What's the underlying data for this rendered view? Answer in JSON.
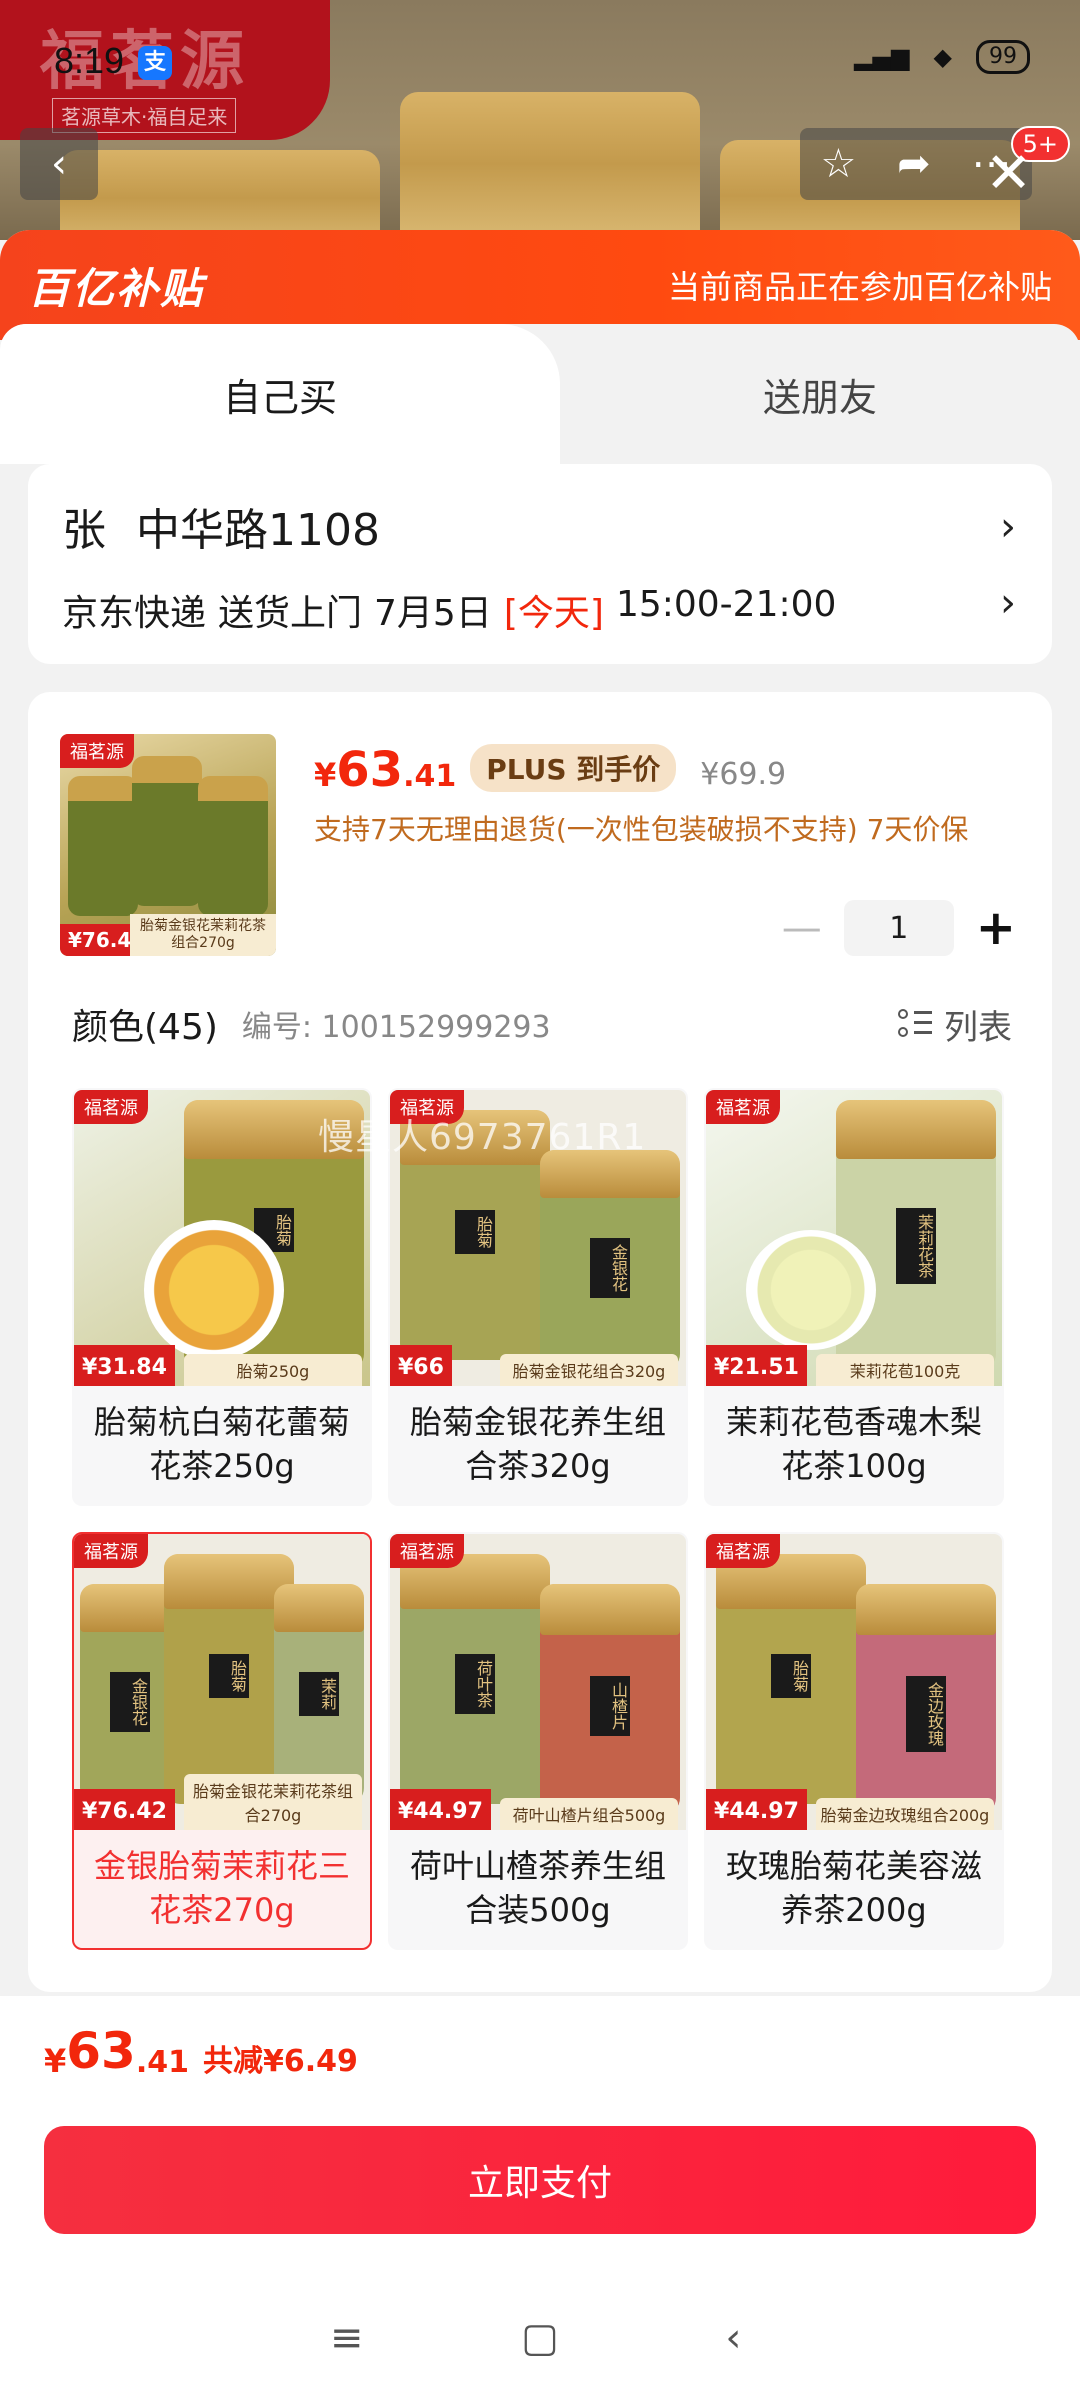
{
  "status": {
    "time": "8:19",
    "app_badge": "支",
    "battery": "99"
  },
  "background": {
    "brand_logo": "福茗源",
    "brand_slogan": "茗源草木·福自足来",
    "cart_count": "5+"
  },
  "banner": {
    "logo": "百亿补贴",
    "text": "当前商品正在参加百亿补贴"
  },
  "tabs": {
    "self": "自己买",
    "friend": "送朋友"
  },
  "address": {
    "name": "张",
    "street": "中华路1108",
    "courier": "京东快递",
    "delivery": "送货上门",
    "date": "7月5日",
    "today": "[今天]",
    "time": "15:00-21:00"
  },
  "product": {
    "thumb": {
      "brand": "福茗源",
      "price": "¥76.42",
      "desc": "胎菊金银花茉莉花茶组合270g"
    },
    "price_yen": "¥",
    "price_int": "63",
    "price_dec": ".41",
    "plus_badge": "PLUS 到手价",
    "price_old": "¥69.9",
    "service": "支持7天无理由退货(一次性包装破损不支持) 7天价保",
    "qty": "1"
  },
  "color_section": {
    "title": "颜色(45)",
    "code": "编号: 100152999293",
    "list_label": "列表",
    "watermark": "慢星人6973761R1",
    "options": [
      {
        "name": "胎菊杭白菊花蕾菊花茶250g",
        "price": "¥31.84",
        "desc": "胎菊250g",
        "brand": "福茗源",
        "selected": false
      },
      {
        "name": "胎菊金银花养生组合茶320g",
        "price": "¥66",
        "desc": "胎菊金银花组合320g",
        "brand": "福茗源",
        "selected": false
      },
      {
        "name": "茉莉花苞香魂木梨花茶100g",
        "price": "¥21.51",
        "desc": "茉莉花苞100克",
        "brand": "福茗源",
        "selected": false
      },
      {
        "name": "金银胎菊茉莉花三花茶270g",
        "price": "¥76.42",
        "desc": "胎菊金银花茉莉花茶组合270g",
        "brand": "福茗源",
        "selected": true
      },
      {
        "name": "荷叶山楂茶养生组合装500g",
        "price": "¥44.97",
        "desc": "荷叶山楂片组合500g",
        "brand": "福茗源",
        "selected": false
      },
      {
        "name": "玫瑰胎菊花美容滋养茶200g",
        "price": "¥44.97",
        "desc": "胎菊金边玫瑰组合200g",
        "brand": "福茗源",
        "selected": false
      }
    ]
  },
  "bottom": {
    "yen": "¥",
    "total_int": "63",
    "total_dec": ".41",
    "reduce": "共减¥6.49",
    "pay_label": "立即支付"
  },
  "icons": [
    "back-icon",
    "star-icon",
    "share-icon",
    "more-icon",
    "close-icon",
    "chevron-right-icon",
    "minus-icon",
    "plus-icon",
    "list-icon",
    "menu-icon",
    "home-icon",
    "back-nav-icon"
  ],
  "colors": {
    "accent": "#f2270c",
    "banner": "#f5431c",
    "pay_button": "#f52f3f",
    "plus_badge": "#f6e2c8"
  }
}
